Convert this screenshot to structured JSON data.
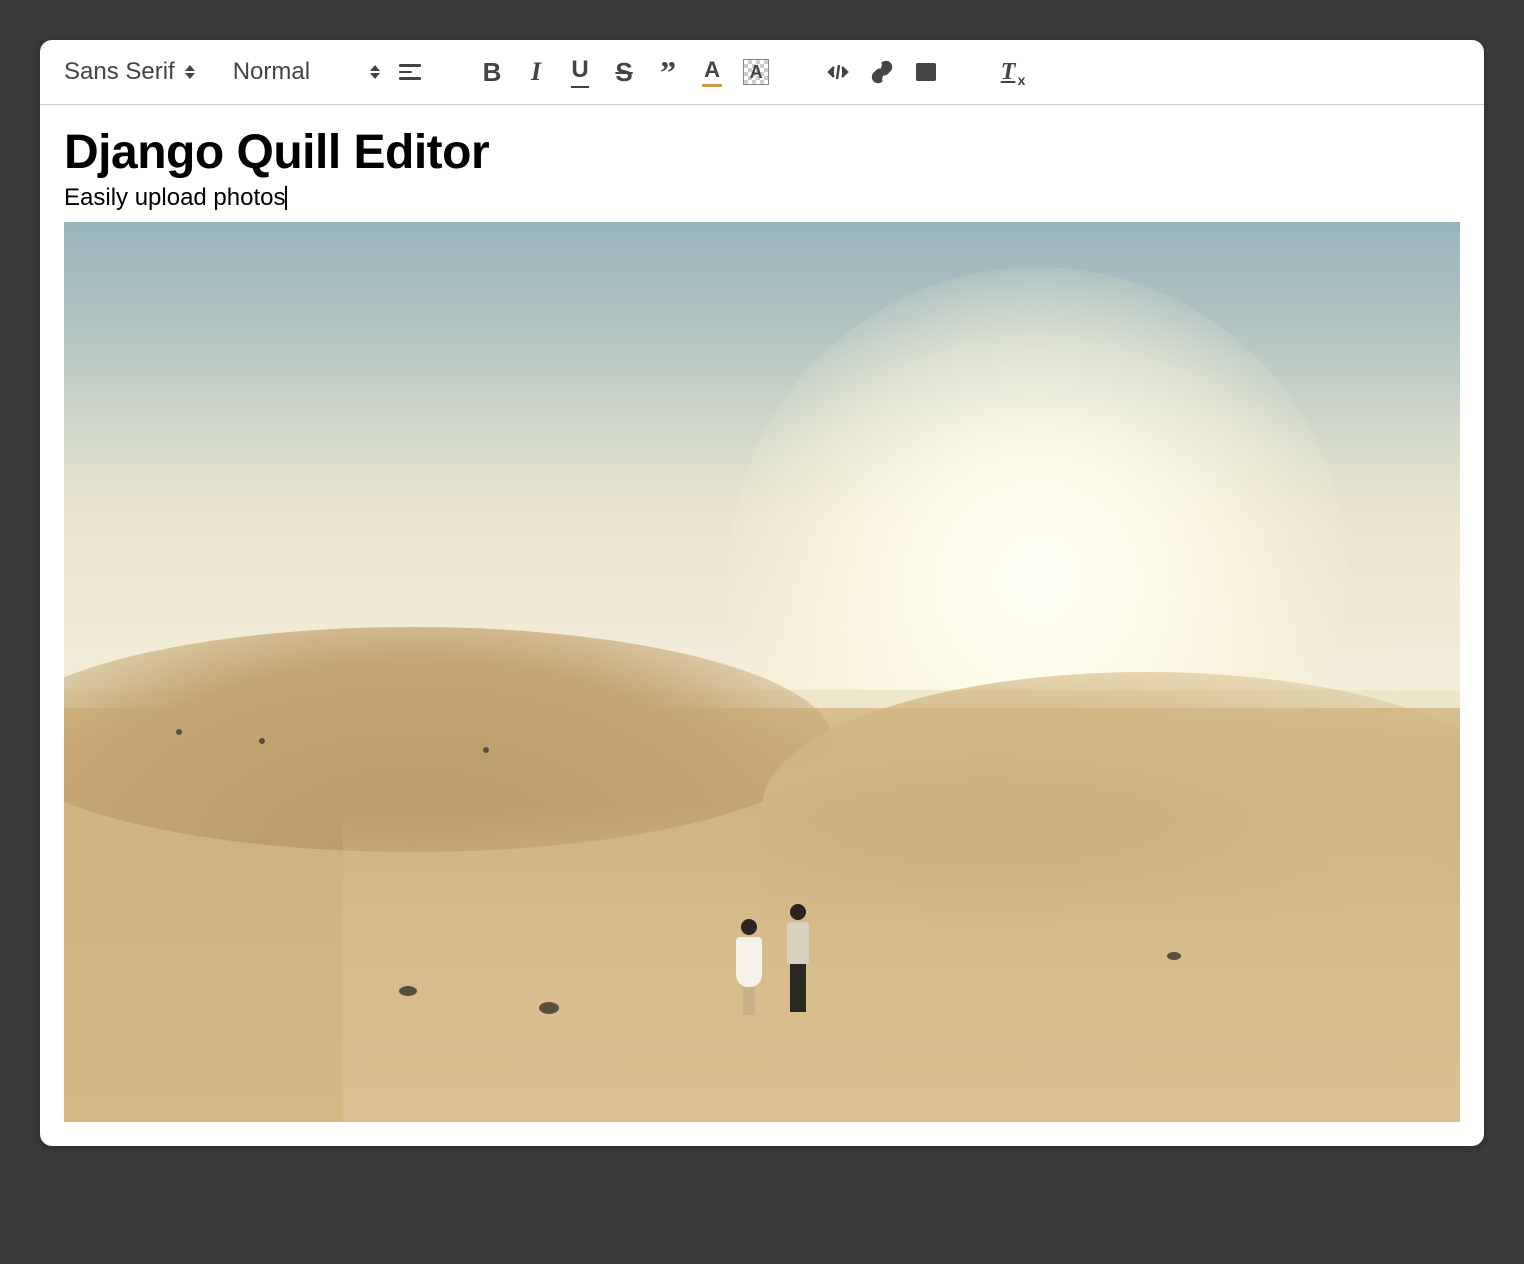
{
  "toolbar": {
    "font_picker": "Sans Serif",
    "size_picker": "Normal"
  },
  "content": {
    "heading": "Django Quill Editor",
    "paragraph": "Easily upload photos"
  },
  "icons": {
    "bold_letter": "B",
    "italic_letter": "I",
    "underline_letter": "U",
    "strike_letter": "S",
    "color_letter": "A",
    "background_letter": "A",
    "clean_letter": "T"
  }
}
